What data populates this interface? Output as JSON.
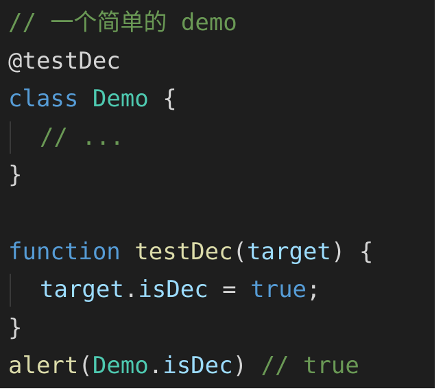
{
  "editor": {
    "lines": [
      {
        "comment": "// 一个简单的 demo"
      },
      {
        "decorator": "@testDec"
      },
      {
        "keyword": "class",
        "class_name": "Demo",
        "brace": "{"
      },
      {
        "comment": "// ..."
      },
      {
        "brace": "}"
      },
      {},
      {
        "keyword": "function",
        "func_name": "testDec",
        "open_paren": "(",
        "param": "target",
        "close_paren": ")",
        "brace": "{"
      },
      {
        "obj": "target",
        "dot": ".",
        "prop": "isDec",
        "op": "=",
        "value": "true",
        "semi": ";"
      },
      {
        "brace": "}"
      },
      {
        "func_name": "alert",
        "open_paren": "(",
        "obj": "Demo",
        "dot": ".",
        "prop": "isDec",
        "close_paren": ")",
        "comment": "// true"
      }
    ]
  },
  "colors": {
    "background": "#1e1e1e",
    "comment": "#6a9955",
    "keyword": "#569cd6",
    "class": "#4ec9b0",
    "function": "#dcdcaa",
    "variable": "#9cdcfe",
    "text": "#d4d4d4"
  }
}
